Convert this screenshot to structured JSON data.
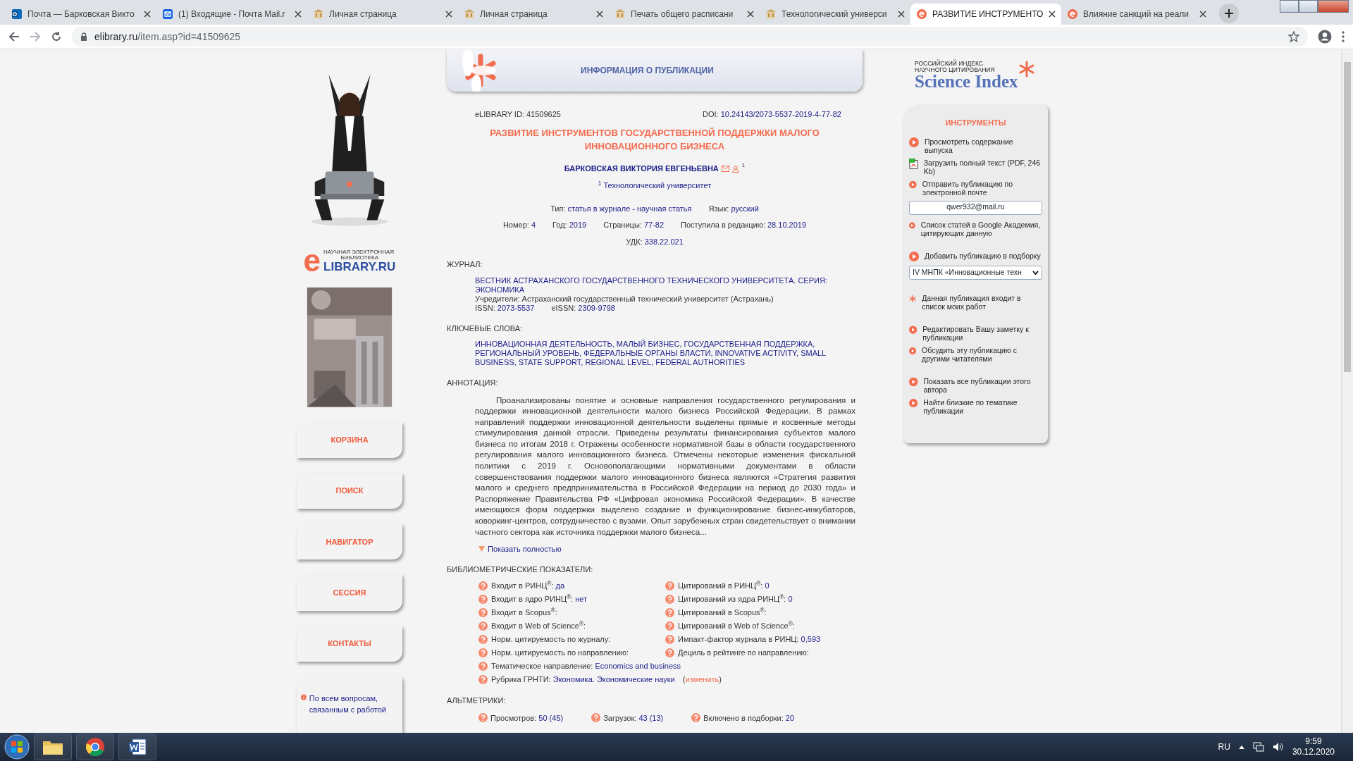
{
  "browser": {
    "tabs": [
      {
        "title": "Почта — Барковская Викто",
        "kind": "outlook",
        "selected": false
      },
      {
        "title": "(1) Входящие - Почта Mail.r",
        "kind": "mail",
        "selected": false
      },
      {
        "title": "Личная страница",
        "kind": "university",
        "selected": false
      },
      {
        "title": "Личная страница",
        "kind": "university",
        "selected": false
      },
      {
        "title": "Печать общего расписани",
        "kind": "university",
        "selected": false
      },
      {
        "title": "Технологический универси",
        "kind": "university",
        "selected": false
      },
      {
        "title": "РАЗВИТИЕ ИНСТРУМЕНТО",
        "kind": "elibrary",
        "selected": true
      },
      {
        "title": "Влияние санкций на реали",
        "kind": "elibrary",
        "selected": false
      }
    ],
    "url_host": "elibrary.ru",
    "url_path": "/item.asp?id=41509625"
  },
  "left": {
    "logo": {
      "mark": "e",
      "line1": "НАУЧНАЯ ЭЛЕКТРОННАЯ",
      "line2": "БИБЛИОТЕКА",
      "brand": "LIBRARY.RU"
    },
    "menu": [
      "КОРЗИНА",
      "ПОИСК",
      "НАВИГАТОР",
      "СЕССИЯ",
      "КОНТАКТЫ"
    ],
    "help": "По всем вопросам, связанным с работой"
  },
  "header": {
    "title": "ИНФОРМАЦИЯ О ПУБЛИКАЦИИ"
  },
  "publication": {
    "id_label": "eLIBRARY ID:",
    "id": "41509625",
    "doi_label": "DOI:",
    "doi": "10.24143/2073-5537-2019-4-77-82",
    "title": "РАЗВИТИЕ ИНСТРУМЕНТОВ ГОСУДАРСТВЕННОЙ ПОДДЕРЖКИ МАЛОГО ИННОВАЦИОННОГО БИЗНЕСА",
    "author": "БАРКОВСКАЯ ВИКТОРИЯ ЕВГЕНЬЕВНА",
    "author_mark": "1",
    "affiliation": "$^{1}$ Технологический университет",
    "meta": [
      [
        {
          "label": "Тип:",
          "value": "статья в журнале - научная статья"
        },
        {
          "label": "Язык:",
          "value": "русский"
        }
      ],
      [
        {
          "label": "Номер:",
          "value": "4"
        },
        {
          "label": "Год:",
          "value": "2019"
        },
        {
          "label": "Страницы:",
          "value": "77-82"
        },
        {
          "label": "Поступила в редакцию:",
          "value": "28.10.2019"
        }
      ],
      [
        {
          "label": "УДК:",
          "value": "338.22.021"
        }
      ]
    ],
    "journal_label": "ЖУРНАЛ:",
    "journal": {
      "name": "ВЕСТНИК АСТРАХАНСКОГО ГОСУДАРСТВЕННОГО ТЕХНИЧЕСКОГО УНИВЕРСИТЕТА. СЕРИЯ: ЭКОНОМИКА",
      "founders": "Учредители: Астраханский государственный технический университет (Астрахань)",
      "issn": [
        {
          "label": "ISSN:",
          "value": "2073-5537"
        },
        {
          "label": "eISSN:",
          "value": "2309-9798"
        }
      ]
    },
    "keywords_label": "КЛЮЧЕВЫЕ СЛОВА:",
    "keywords": "ИННОВАЦИОННАЯ ДЕЯТЕЛЬНОСТЬ, МАЛЫЙ БИЗНЕС, ГОСУДАРСТВЕННАЯ ПОДДЕРЖКА, РЕГИОНАЛЬНЫЙ УРОВЕНЬ, ФЕДЕРАЛЬНЫЕ ОРГАНЫ ВЛАСТИ, INNOVATIVE ACTIVITY, SMALL BUSINESS, STATE SUPPORT, REGIONAL LEVEL, FEDERAL AUTHORITIES",
    "abstract_label": "АННОТАЦИЯ:",
    "abstract": "Проанализированы понятие и основные направления государственного регулирования и поддержки инновационной деятельности малого бизнеса Российской Федерации. В рамках направлений поддержки инновационной деятельности выделены прямые и косвенные методы стимулирования данной отрасли. Приведены результаты финансирования субъектов малого бизнеса по итогам 2018 г. Отражены особенности нормативной базы в области государственного регулирования малого инновационного бизнеса. Отмечены некоторые изменения фискальной политики с 2019 г. Основополагающими нормативными документами в области совершенствования поддержки малого инновационного бизнеса являются «Стратегия развития малого и среднего предпринимательства в Российской Федерации на период до 2030 года» и Распоряжение Правительства РФ «Цифровая экономика Российской Федерации». В качестве имеющихся форм поддержки выделено создание и функционирование бизнес-инкубаторов, коворкинг-центров, сотрудничество с вузами. Опыт зарубежных стран свидетельствует о внимании частного сектора как источника поддержки малого бизнеса...",
    "show_full": "Показать полностью",
    "biblio_label": "БИБЛИОМЕТРИЧЕСКИЕ ПОКАЗАТЕЛИ:",
    "biblio": [
      [
        {
          "label": "Входит в РИНЦ$^{®}$:",
          "value": "да"
        },
        {
          "label": "Цитирований в РИНЦ$^{®}$:",
          "value": "0"
        }
      ],
      [
        {
          "label": "Входит в ядро РИНЦ$^{®}$:",
          "value": "нет"
        },
        {
          "label": "Цитирований из ядра РИНЦ$^{®}$:",
          "value": "0"
        }
      ],
      [
        {
          "label": "Входит в Scopus$^{®}$:"
        },
        {
          "label": "Цитирований в Scopus$^{®}$:"
        }
      ],
      [
        {
          "label": "Входит в Web of Science$^{®}$:"
        },
        {
          "label": "Цитирований в Web of Science$^{®}$:"
        }
      ],
      [
        {
          "label": "Норм. цитируемость по журналу:"
        },
        {
          "label": "Импакт-фактор журнала в РИНЦ:",
          "value": "0,593"
        }
      ],
      [
        {
          "label": "Норм. цитируемость по направлению:"
        },
        {
          "label": "Дециль в рейтинге по направлению:"
        }
      ],
      [
        {
          "label": "Тематическое направление:",
          "value": "Economics and business"
        }
      ],
      [
        {
          "label": "Рубрика ГРНТИ:",
          "value": "Экономика. Экономические науки",
          "action_open": "(",
          "action": "изменить",
          "action_close": ")"
        }
      ]
    ],
    "altmetrics_label": "АЛЬТМЕТРИКИ:",
    "altmetrics": [
      {
        "label": "Просмотров:",
        "value": "50 (45)"
      },
      {
        "label": "Загрузок:",
        "value": "43 (13)"
      },
      {
        "label": "Включено в подборки:",
        "value": "20"
      }
    ]
  },
  "right": {
    "logo": {
      "line1": "РОССИЙСКИЙ ИНДЕКС",
      "line2": "НАУЧНОГО ЦИТИРОВАНИЯ",
      "brand": "Science Index"
    },
    "tools_title": "ИНСТРУМЕНТЫ",
    "groups": [
      [
        {
          "kind": "link",
          "text": "Просмотреть содержание выпуска"
        },
        {
          "kind": "pdf",
          "text": "Загрузить полный текст (PDF, 246 Kb)"
        },
        {
          "kind": "link",
          "text": "Отправить публикацию по электронной почте"
        },
        {
          "kind": "field",
          "text": "qwer932@mail.ru"
        },
        {
          "kind": "link",
          "text": "Список статей в Google Академия, цитирующих данную"
        }
      ],
      [
        {
          "kind": "link",
          "text": "Добавить публикацию в подборку"
        },
        {
          "kind": "select",
          "text": "IV МНПК «Инновационные техн"
        }
      ],
      [
        {
          "kind": "star",
          "text": "Данная публикация входит в список моих работ"
        }
      ],
      [
        {
          "kind": "link",
          "text": "Редактировать Вашу заметку к публикации"
        },
        {
          "kind": "link",
          "text": "Обсудить эту публикацию с другими читателями"
        }
      ],
      [
        {
          "kind": "link",
          "text": "Показать все публикации этого автора"
        },
        {
          "kind": "link",
          "text": "Найти близкие по тематике публикации"
        }
      ]
    ]
  },
  "taskbar": {
    "language": "RU",
    "time": "9:59",
    "date": "30.12.2020"
  }
}
